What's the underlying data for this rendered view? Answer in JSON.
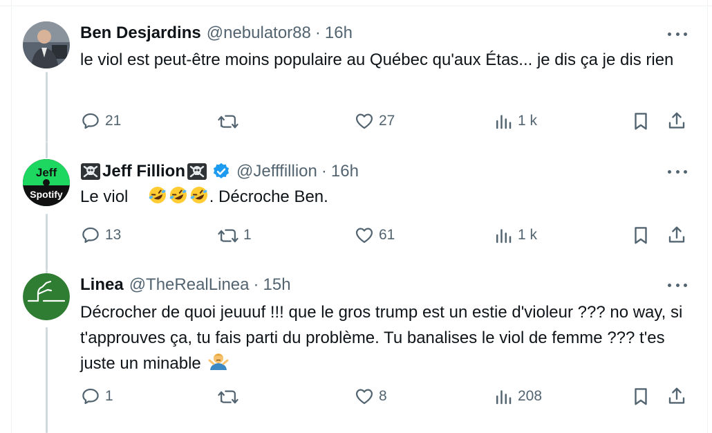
{
  "tweets": [
    {
      "name": "Ben Desjardins",
      "handle": "@nebulator88",
      "separator": "·",
      "time": "16h",
      "text": "le viol est peut-être moins populaire au Québec qu'aux Étas... je dis ça je dis rien",
      "replies": "21",
      "retweets": "",
      "likes": "27",
      "views": "1 k"
    },
    {
      "name_prefix_icon": "skull-crossbones",
      "name": "Jeff Fillion",
      "name_suffix_icon": "skull-crossbones",
      "verified": true,
      "handle": "@Jefffillion",
      "separator": "·",
      "time": "16h",
      "text_before": "Le viol",
      "emojis": [
        "rolling-on-floor-laughing",
        "rolling-on-floor-laughing",
        "rolling-on-floor-laughing"
      ],
      "text_after": ". Décroche Ben.",
      "avatar_text_top": "Jeff",
      "avatar_text_bottom": "Spotify",
      "replies": "13",
      "retweets": "1",
      "likes": "61",
      "views": "1 k"
    },
    {
      "name": "Linea",
      "handle": "@TheRealLinea",
      "separator": "·",
      "time": "15h",
      "text": "Décrocher de quoi jeuuuf !!! que le gros trump est un estie d'violeur ??? no way, si t'approuves ça, tu fais parti du problème. Tu banalises le viol de femme ??? t'es juste un minable",
      "trailing_emoji": "man-shrugging",
      "replies": "1",
      "retweets": "",
      "likes": "8",
      "views": "208"
    }
  ],
  "colors": {
    "text": "#0f1419",
    "muted": "#536471",
    "verified": "#1d9bf0",
    "thread_line": "#cfd9de",
    "spotify_green": "#1ed760",
    "linea_green": "#2e7d32"
  }
}
